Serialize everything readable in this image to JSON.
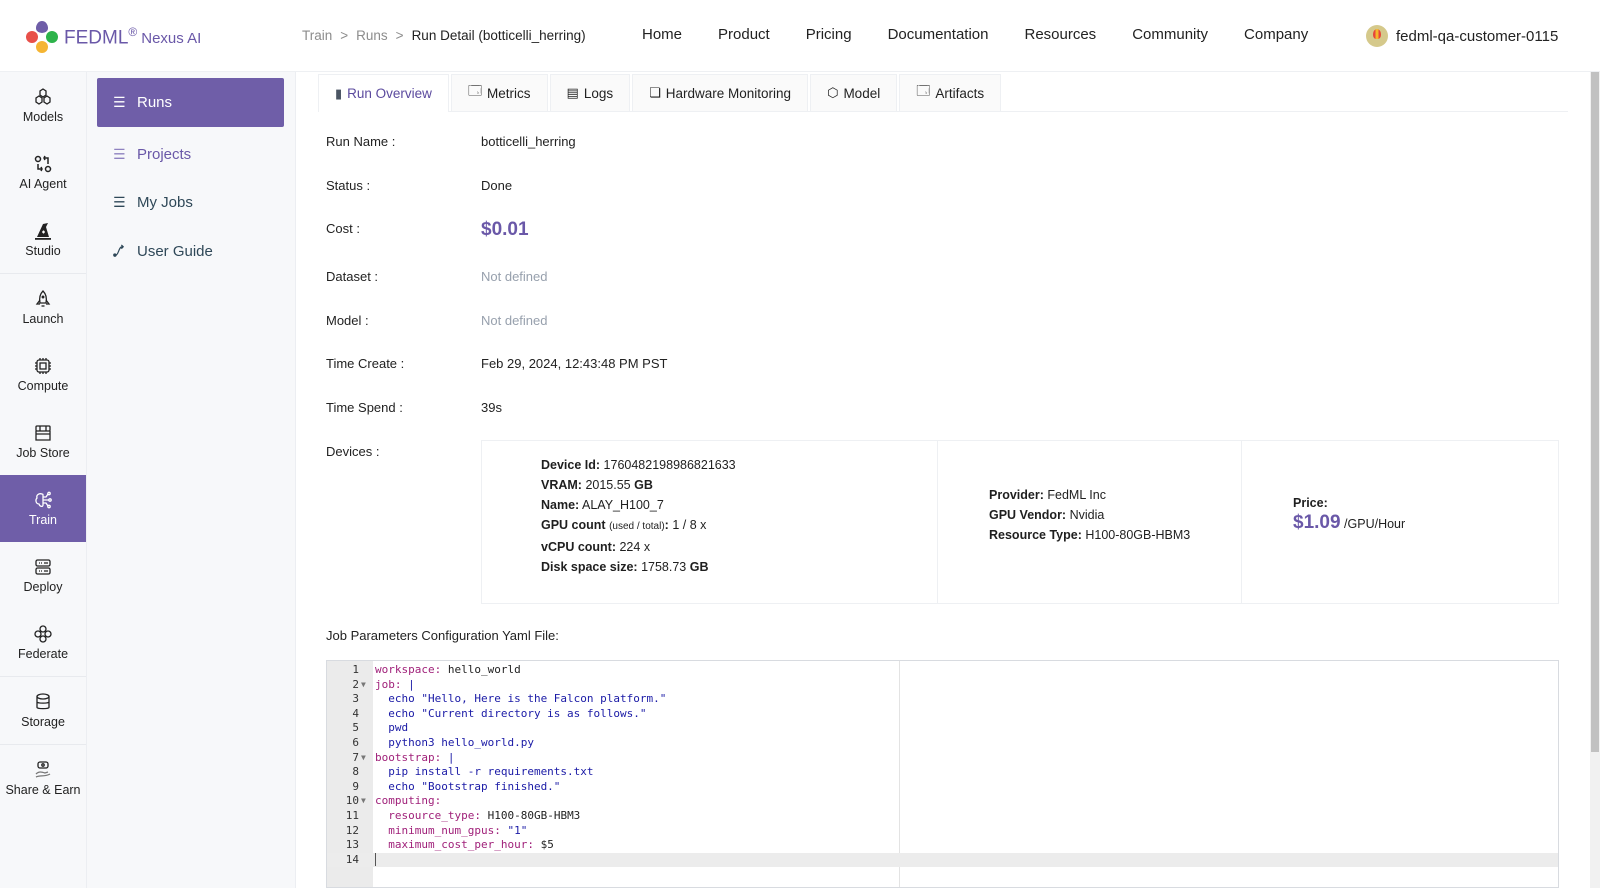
{
  "brand": {
    "name": "FEDML",
    "registered": "®",
    "suffix": "Nexus AI",
    "colors": {
      "purple": "#6f5ea8",
      "red": "#e8504a",
      "green": "#2db34a",
      "orange": "#f5b533",
      "violet": "#6a58a8"
    }
  },
  "breadcrumb": {
    "items": [
      "Train",
      "Runs"
    ],
    "separator": ">",
    "current": "Run Detail (botticelli_herring)"
  },
  "topnav": {
    "items": [
      "Home",
      "Product",
      "Pricing",
      "Documentation",
      "Resources",
      "Community",
      "Company"
    ]
  },
  "user": {
    "name": "fedml-qa-customer-0115",
    "avatar_icon": "hot-air-balloon-icon"
  },
  "rail": {
    "items": [
      {
        "label": "Models",
        "icon": "models-icon"
      },
      {
        "label": "AI Agent",
        "icon": "ai-agent-icon"
      },
      {
        "label": "Studio",
        "icon": "studio-icon"
      },
      {
        "label": "Launch",
        "icon": "rocket-icon"
      },
      {
        "label": "Compute",
        "icon": "chip-icon"
      },
      {
        "label": "Job Store",
        "icon": "store-icon"
      },
      {
        "label": "Train",
        "icon": "brain-icon",
        "active": true
      },
      {
        "label": "Deploy",
        "icon": "server-icon"
      },
      {
        "label": "Federate",
        "icon": "federate-icon"
      },
      {
        "label": "Storage",
        "icon": "database-icon"
      },
      {
        "label": "Share & Earn",
        "icon": "share-earn-icon"
      }
    ]
  },
  "subnav": {
    "items": [
      {
        "label": "Runs",
        "icon": "list-icon",
        "active": true
      },
      {
        "label": "Projects",
        "icon": "list-icon"
      },
      {
        "label": "My Jobs",
        "icon": "list-icon"
      },
      {
        "label": "User Guide",
        "icon": "guide-icon"
      }
    ]
  },
  "tabs": [
    {
      "label": "Run Overview",
      "icon": "phone-icon",
      "active": true
    },
    {
      "label": "Metrics",
      "icon": "monitor-icon"
    },
    {
      "label": "Logs",
      "icon": "document-icon"
    },
    {
      "label": "Hardware Monitoring",
      "icon": "window-icon"
    },
    {
      "label": "Model",
      "icon": "cube-icon"
    },
    {
      "label": "Artifacts",
      "icon": "monitor-icon"
    }
  ],
  "overview": {
    "run_name": {
      "label": "Run Name",
      "value": "botticelli_herring"
    },
    "status": {
      "label": "Status",
      "value": "Done"
    },
    "cost": {
      "label": "Cost",
      "value": "$0.01"
    },
    "dataset": {
      "label": "Dataset",
      "value": "Not defined"
    },
    "model": {
      "label": "Model",
      "value": "Not defined"
    },
    "time_create": {
      "label": "Time Create",
      "value": "Feb 29, 2024, 12:43:48 PM PST"
    },
    "time_spend": {
      "label": "Time Spend",
      "value": "39s"
    },
    "devices_label": "Devices"
  },
  "device": {
    "device_id": {
      "label": "Device Id:",
      "value": "1760482198986821633"
    },
    "vram": {
      "label": "VRAM:",
      "value": "2015.55",
      "unit": "GB"
    },
    "name": {
      "label": "Name:",
      "value": "ALAY_H100_7"
    },
    "gpu_count": {
      "label": "GPU count",
      "hint": "(used / total)",
      "value": "1 / 8 x"
    },
    "vcpu_count": {
      "label": "vCPU count:",
      "value": "224 x"
    },
    "disk": {
      "label": "Disk space size:",
      "value": "1758.73",
      "unit": "GB"
    },
    "provider": {
      "label": "Provider:",
      "value": "FedML Inc"
    },
    "gpu_vendor": {
      "label": "GPU Vendor:",
      "value": "Nvidia"
    },
    "resource_type": {
      "label": "Resource Type:",
      "value": "H100-80GB-HBM3"
    },
    "price": {
      "label": "Price:",
      "value": "$1.09",
      "unit": "/GPU/Hour"
    }
  },
  "yaml": {
    "title": "Job Parameters Configuration Yaml File:",
    "lines": [
      {
        "n": "1",
        "fold": false,
        "tokens": [
          [
            "k",
            "workspace: "
          ],
          [
            "p",
            "hello_world"
          ]
        ]
      },
      {
        "n": "2",
        "fold": true,
        "tokens": [
          [
            "k",
            "job: "
          ],
          [
            "s",
            "|"
          ]
        ]
      },
      {
        "n": "3",
        "fold": false,
        "tokens": [
          [
            "s",
            "  echo \"Hello, Here is the Falcon platform.\""
          ]
        ]
      },
      {
        "n": "4",
        "fold": false,
        "tokens": [
          [
            "s",
            "  echo \"Current directory is as follows.\""
          ]
        ]
      },
      {
        "n": "5",
        "fold": false,
        "tokens": [
          [
            "s",
            "  pwd"
          ]
        ]
      },
      {
        "n": "6",
        "fold": false,
        "tokens": [
          [
            "s",
            "  python3 hello_world.py"
          ]
        ]
      },
      {
        "n": "7",
        "fold": true,
        "tokens": [
          [
            "k",
            "bootstrap: "
          ],
          [
            "s",
            "|"
          ]
        ]
      },
      {
        "n": "8",
        "fold": false,
        "tokens": [
          [
            "s",
            "  pip install -r requirements.txt"
          ]
        ]
      },
      {
        "n": "9",
        "fold": false,
        "tokens": [
          [
            "s",
            "  echo \"Bootstrap finished.\""
          ]
        ]
      },
      {
        "n": "10",
        "fold": true,
        "tokens": [
          [
            "k",
            "computing:"
          ]
        ]
      },
      {
        "n": "11",
        "fold": false,
        "tokens": [
          [
            "k",
            "  resource_type: "
          ],
          [
            "p",
            "H100-80GB-HBM3"
          ]
        ]
      },
      {
        "n": "12",
        "fold": false,
        "tokens": [
          [
            "k",
            "  minimum_num_gpus: "
          ],
          [
            "s",
            "\"1\""
          ]
        ]
      },
      {
        "n": "13",
        "fold": false,
        "tokens": [
          [
            "k",
            "  maximum_cost_per_hour: "
          ],
          [
            "p",
            "$5"
          ]
        ]
      },
      {
        "n": "14",
        "fold": false,
        "active": true,
        "tokens": []
      }
    ]
  }
}
